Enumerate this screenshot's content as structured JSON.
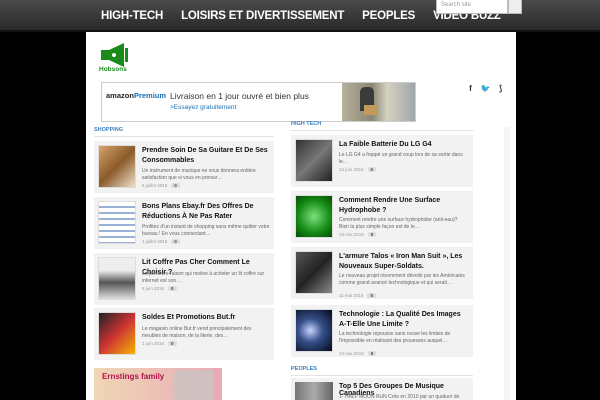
{
  "nav": {
    "items": [
      "HIGH-TECH",
      "LOISIRS ET DIVERTISSEMENT",
      "PEOPLES",
      "VIDEO BUZZ"
    ],
    "search_placeholder": "Search site"
  },
  "logo": {
    "text": "Hobsons",
    "icon": "megaphone-icon",
    "color": "#1a8a1a"
  },
  "banner": {
    "brand_a": "amazon",
    "brand_b": "Premium",
    "sub": "",
    "headline": "Livraison en 1 jour ouvré et bien plus",
    "link": ">Essayez gratuitement"
  },
  "social": [
    "f",
    "t",
    "rss"
  ],
  "shopping": {
    "title": "SHOPPING",
    "articles": [
      {
        "title": "Prendre Soin De Sa Guitare Et De Ses Consommables",
        "excerpt": "Un instrument de musique ne vous donnera entière satisfaction que si vous en prenez…",
        "date": "5 juillet 2016",
        "count": "0"
      },
      {
        "title": "Bons Plans Ebay.fr Des Offres De Réductions À Ne Pas Rater",
        "excerpt": "Profitez d'un instant de shopping sans même quitter votre bureau ! En vous connectant…",
        "date": "1 juillet 2016",
        "count": "0"
      },
      {
        "title": "Lit Coffre Pas Cher Comment Le Choisir ?",
        "excerpt": "La première raison qui motive à acheter un lit coffre sur internet est son…",
        "date": "6 juin 2016",
        "count": "0"
      },
      {
        "title": "Soldes Et Promotions But.fr",
        "excerpt": "Le magasin online But.fr vend principalement des meubles de maison, de la literie, des…",
        "date": "1 juin 2016",
        "count": "0"
      }
    ]
  },
  "hightech": {
    "title": "HIGH TECH",
    "articles": [
      {
        "title": "La Faible Batterie Du LG G4",
        "excerpt": "Le LG G4 a frappé un grand coup lors de sa sortie dans le…",
        "date": "12 juin 2015",
        "count": "0"
      },
      {
        "title": "Comment Rendre Une Surface Hydrophobe ?",
        "excerpt": "Comment rendre une surface hydrophobe (anti-eau)? Bien la plus simple façon est de le…",
        "date": "15 mai 2015",
        "count": "0"
      },
      {
        "title": "L'armure Talos « Iron Man Suit », Les Nouveaux Super-Soldats.",
        "excerpt": "Le nouveau projet récemment dévoilé par les Américains comme grand avancé technologique et qui serait…",
        "date": "11 mai 2015",
        "count": "0"
      },
      {
        "title": "Technologie : La Qualité Des Images A-T-Elle Une Limite ?",
        "excerpt": "La technologie repousse sans cesse les limites de l'impossible en réalisant des prouesses auquel…",
        "date": "10 mai 2015",
        "count": "0"
      }
    ]
  },
  "people": {
    "title": "PEOPLES",
    "article_title": "Top 5 Des Groupes De Musique Canadiens",
    "article_excerpt": "1- HALF MOON RUN Crée en 2010 par un quatuor de"
  },
  "ad": {
    "text": "Ernstings family"
  }
}
